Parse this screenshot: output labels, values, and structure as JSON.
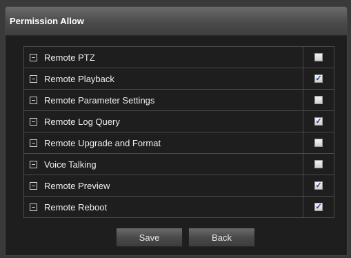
{
  "dialog": {
    "title": "Permission Allow"
  },
  "permissions": [
    {
      "label": "Remote PTZ",
      "checked": false
    },
    {
      "label": "Remote Playback",
      "checked": true
    },
    {
      "label": "Remote Parameter Settings",
      "checked": false
    },
    {
      "label": "Remote Log Query",
      "checked": true
    },
    {
      "label": "Remote Upgrade and Format",
      "checked": false
    },
    {
      "label": "Voice Talking",
      "checked": false
    },
    {
      "label": "Remote Preview",
      "checked": true
    },
    {
      "label": "Remote Reboot",
      "checked": true
    }
  ],
  "buttons": {
    "save_label": "Save",
    "back_label": "Back"
  },
  "check_mark": "✓"
}
